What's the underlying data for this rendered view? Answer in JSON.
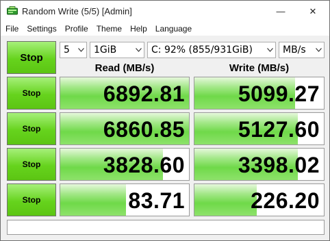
{
  "window": {
    "title": "Random Write (5/5) [Admin]",
    "minimize_glyph": "—",
    "maximize_glyph": "☐",
    "close_glyph": "✕"
  },
  "menu": [
    "File",
    "Settings",
    "Profile",
    "Theme",
    "Help",
    "Language"
  ],
  "toolbar": {
    "stop_all_label": "Stop",
    "count": "5",
    "size": "1GiB",
    "drive": "C: 92% (855/931GiB)",
    "unit": "MB/s"
  },
  "headers": {
    "read": "Read (MB/s)",
    "write": "Write (MB/s)"
  },
  "rows": [
    {
      "stop_label": "Stop",
      "read": "6892.81",
      "write": "5099.27",
      "read_fill": 1.0,
      "write_fill": 0.78
    },
    {
      "stop_label": "Stop",
      "read": "6860.85",
      "write": "5127.60",
      "read_fill": 1.0,
      "write_fill": 0.8
    },
    {
      "stop_label": "Stop",
      "read": "3828.60",
      "write": "3398.02",
      "read_fill": 0.8,
      "write_fill": 0.8
    },
    {
      "stop_label": "Stop",
      "read": "83.71",
      "write": "226.20",
      "read_fill": 0.51,
      "write_fill": 0.48
    }
  ],
  "colors": {
    "accent_green": "#66d31d",
    "bar_green": "#6fd949"
  }
}
